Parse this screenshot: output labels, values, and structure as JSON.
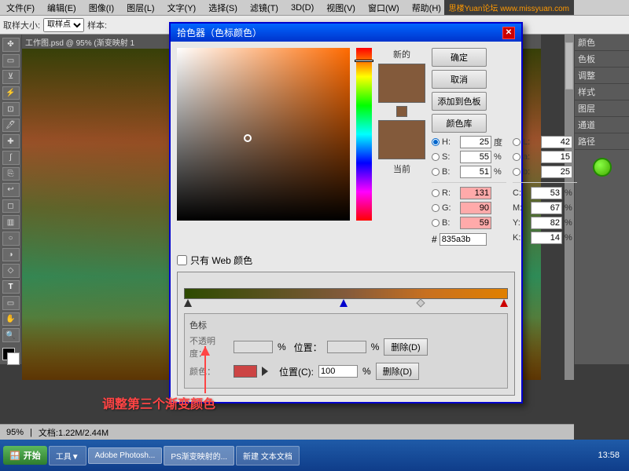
{
  "app": {
    "title": "Adobe Photoshop",
    "menu": [
      "文件(F)",
      "编辑(E)",
      "图像(I)",
      "图层(L)",
      "文字(Y)",
      "选择(S)",
      "滤镜(T)",
      "3D(D)",
      "视图(V)",
      "窗口(W)",
      "帮助(H)"
    ]
  },
  "toolbar": {
    "sample_size_label": "取样大小:",
    "sample_size_value": "取样点",
    "sample_label": "样本:"
  },
  "dialogs": {
    "color_picker": {
      "title": "拾色器（色标颜色）",
      "new_label": "新的",
      "current_label": "当前",
      "ok_btn": "确定",
      "cancel_btn": "取消",
      "add_to_swatches_btn": "添加到色板",
      "color_library_btn": "颜色库",
      "web_safe_label": "只有 Web 颜色",
      "h_label": "H:",
      "h_value": "25",
      "h_unit": "度",
      "s_label": "S:",
      "s_value": "55",
      "s_unit": "%",
      "b_label": "B:",
      "b_value": "51",
      "b_unit": "%",
      "r_label": "R:",
      "r_value": "131",
      "g_label": "G:",
      "g_value": "90",
      "b2_label": "B:",
      "b2_value": "59",
      "l_label": "L:",
      "l_value": "42",
      "a_label": "a:",
      "a_value": "15",
      "b3_label": "b:",
      "b3_value": "25",
      "c_label": "C:",
      "c_value": "53",
      "c_unit": "%",
      "m_label": "M:",
      "m_value": "67",
      "m_unit": "%",
      "y_label": "Y:",
      "y_value": "82",
      "y_unit": "%",
      "k_label": "K:",
      "k_value": "14",
      "k_unit": "%",
      "hex_label": "#",
      "hex_value": "835a3b"
    },
    "gradient_editor": {
      "color_stop_title": "色标",
      "opacity_label": "不透明度：",
      "opacity_unit": "%",
      "position_label_top": "位置：",
      "position_unit_top": "%",
      "delete_top_btn": "删除(D)",
      "color_label": "颜色：",
      "position_label": "位置(C):",
      "position_value": "100",
      "position_unit": "%",
      "delete_btn": "删除(D)"
    }
  },
  "canvas": {
    "title": "工作图.psd @ 95% (渐变映射 1",
    "zoom": "95%",
    "doc_size": "文档:1.22M/2.44M"
  },
  "annotation": {
    "text": "调整第三个渐变颜色"
  },
  "taskbar": {
    "start_btn": "开始",
    "items": [
      "工具▼",
      "Adobe Photosh...",
      "PS渐变映射的...",
      "新建 文本文档"
    ],
    "clock": "13:58"
  },
  "site_badge": {
    "text": "思楼Yuan论坛 www.missyuan.com"
  },
  "right_panels": {
    "tabs": [
      "颜色",
      "色板",
      "调整",
      "样式",
      "图层",
      "通道",
      "路径"
    ]
  }
}
